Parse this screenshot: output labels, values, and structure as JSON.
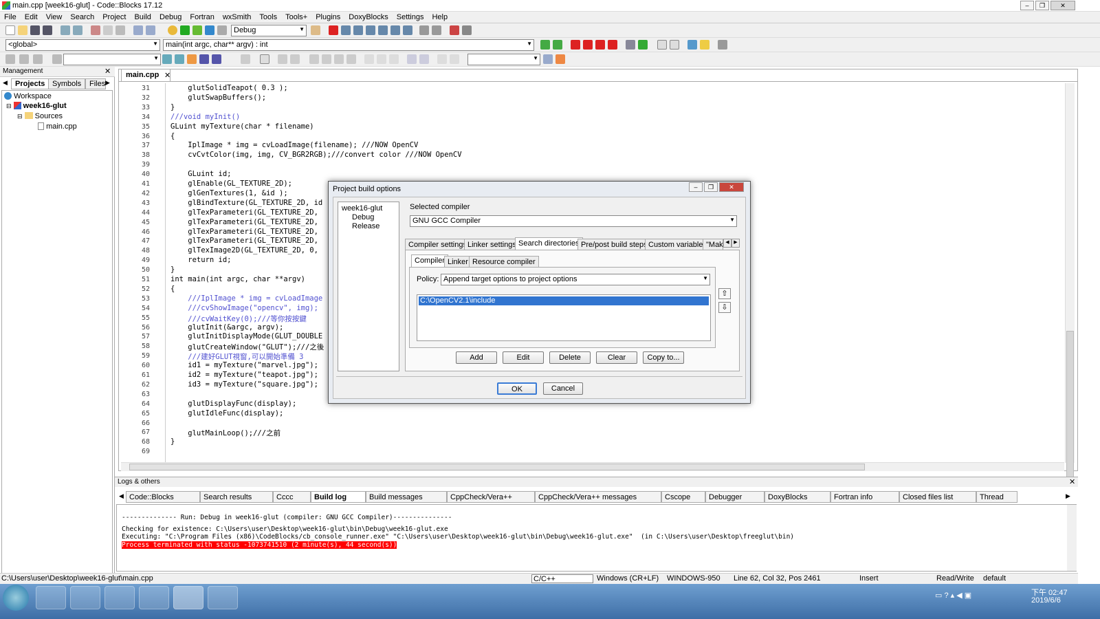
{
  "window": {
    "title": "main.cpp [week16-glut] - Code::Blocks 17.12"
  },
  "menu": [
    "File",
    "Edit",
    "View",
    "Search",
    "Project",
    "Build",
    "Debug",
    "Fortran",
    "wxSmith",
    "Tools",
    "Tools+",
    "Plugins",
    "DoxyBlocks",
    "Settings",
    "Help"
  ],
  "toolbar": {
    "build_target": "Debug",
    "scope": "<global>",
    "function": "main(int argc, char** argv) : int"
  },
  "management": {
    "title": "Management",
    "tabs": [
      "Projects",
      "Symbols",
      "Files"
    ],
    "tree": [
      "Workspace",
      "week16-glut",
      "Sources",
      "main.cpp"
    ]
  },
  "editor": {
    "tab": "main.cpp",
    "lines": [
      {
        "n": "31",
        "t": "    glutSolidTeapot( 0.3 );"
      },
      {
        "n": "32",
        "t": "    glutSwapBuffers();"
      },
      {
        "n": "33",
        "t": "}"
      },
      {
        "n": "34",
        "t": "///void myInit()"
      },
      {
        "n": "35",
        "t": "GLuint myTexture(char * filename)"
      },
      {
        "n": "36",
        "t": "{"
      },
      {
        "n": "37",
        "t": "    IplImage * img = cvLoadImage(filename); ///NOW OpenCV"
      },
      {
        "n": "38",
        "t": "    cvCvtColor(img, img, CV_BGR2RGB);///convert color ///NOW OpenCV"
      },
      {
        "n": "39",
        "t": ""
      },
      {
        "n": "40",
        "t": "    GLuint id;"
      },
      {
        "n": "41",
        "t": "    glEnable(GL_TEXTURE_2D);"
      },
      {
        "n": "42",
        "t": "    glGenTextures(1, &id );"
      },
      {
        "n": "43",
        "t": "    glBindTexture(GL_TEXTURE_2D, id"
      },
      {
        "n": "44",
        "t": "    glTexParameteri(GL_TEXTURE_2D,"
      },
      {
        "n": "45",
        "t": "    glTexParameteri(GL_TEXTURE_2D,"
      },
      {
        "n": "46",
        "t": "    glTexParameteri(GL_TEXTURE_2D,"
      },
      {
        "n": "47",
        "t": "    glTexParameteri(GL_TEXTURE_2D,"
      },
      {
        "n": "48",
        "t": "    glTexImage2D(GL_TEXTURE_2D, 0,"
      },
      {
        "n": "49",
        "t": "    return id;"
      },
      {
        "n": "50",
        "t": "}"
      },
      {
        "n": "51",
        "t": "int main(int argc, char **argv)"
      },
      {
        "n": "52",
        "t": "{"
      },
      {
        "n": "53",
        "t": "    ///IplImage * img = cvLoadImage"
      },
      {
        "n": "54",
        "t": "    ///cvShowImage(\"opencv\", img);"
      },
      {
        "n": "55",
        "t": "    ///cvWaitKey(0);///等你按按鍵"
      },
      {
        "n": "56",
        "t": "    glutInit(&argc, argv);"
      },
      {
        "n": "57",
        "t": "    glutInitDisplayMode(GLUT_DOUBLE"
      },
      {
        "n": "58",
        "t": "    glutCreateWindow(\"GLUT\");///之後"
      },
      {
        "n": "59",
        "t": "    ///建好GLUT視窗,可以開始準備 3"
      },
      {
        "n": "60",
        "t": "    id1 = myTexture(\"marvel.jpg\");"
      },
      {
        "n": "61",
        "t": "    id2 = myTexture(\"teapot.jpg\");"
      },
      {
        "n": "62",
        "t": "    id3 = myTexture(\"square.jpg\");"
      },
      {
        "n": "63",
        "t": ""
      },
      {
        "n": "64",
        "t": "    glutDisplayFunc(display);"
      },
      {
        "n": "65",
        "t": "    glutIdleFunc(display);"
      },
      {
        "n": "66",
        "t": ""
      },
      {
        "n": "67",
        "t": "    glutMainLoop();///之前"
      },
      {
        "n": "68",
        "t": "}"
      },
      {
        "n": "69",
        "t": ""
      }
    ]
  },
  "dialog": {
    "title": "Project build options",
    "tree": [
      "week16-glut",
      "Debug",
      "Release"
    ],
    "selected_compiler_label": "Selected compiler",
    "compiler": "GNU GCC Compiler",
    "tabs": [
      "Compiler settings",
      "Linker settings",
      "Search directories",
      "Pre/post build steps",
      "Custom variables",
      "\"Make"
    ],
    "subtabs": [
      "Compiler",
      "Linker",
      "Resource compiler"
    ],
    "policy_label": "Policy:",
    "policy": "Append target options to project options",
    "dirs": [
      "C:\\OpenCV2.1\\include"
    ],
    "buttons": [
      "Add",
      "Edit",
      "Delete",
      "Clear",
      "Copy to..."
    ],
    "ok": "OK",
    "cancel": "Cancel"
  },
  "logs": {
    "title": "Logs & others",
    "tabs": [
      "Code::Blocks",
      "Search results",
      "Cccc",
      "Build log",
      "Build messages",
      "CppCheck/Vera++",
      "CppCheck/Vera++ messages",
      "Cscope",
      "Debugger",
      "DoxyBlocks",
      "Fortran info",
      "Closed files list",
      "Thread"
    ],
    "lines": [
      "-------------- Run: Debug in week16-glut (compiler: GNU GCC Compiler)---------------",
      "Checking for existence: C:\\Users\\user\\Desktop\\week16-glut\\bin\\Debug\\week16-glut.exe",
      "Executing: \"C:\\Program Files (x86)\\CodeBlocks/cb_console_runner.exe\" \"C:\\Users\\user\\Desktop\\week16-glut\\bin\\Debug\\week16-glut.exe\"  (in C:\\Users\\user\\Desktop\\freeglut\\bin)"
    ],
    "error": "Process terminated with status -1073741510 (2 minute(s), 44 second(s))"
  },
  "status": {
    "path": "C:\\Users\\user\\Desktop\\week16-glut\\main.cpp",
    "lang": "C/C++",
    "eol": "Windows (CR+LF)",
    "enc": "WINDOWS-950",
    "pos": "Line 62, Col 32, Pos 2461",
    "mode": "Insert",
    "rw": "Read/Write",
    "prof": "default"
  },
  "taskbar": {
    "time": "下午 02:47",
    "date": "2019/6/6"
  }
}
